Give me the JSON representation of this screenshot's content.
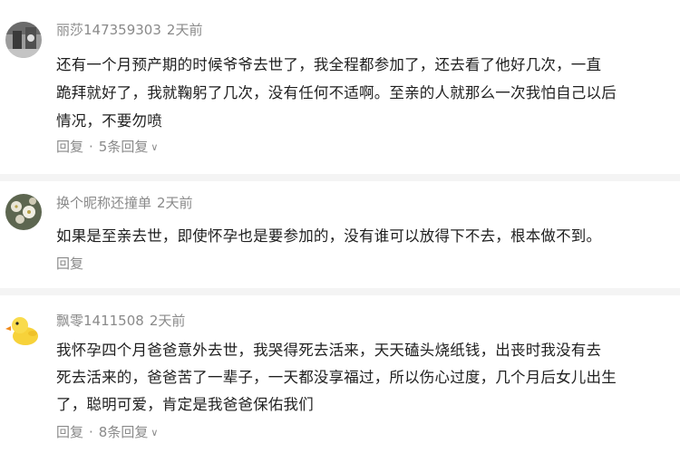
{
  "comments": [
    {
      "username": "丽莎147359303",
      "time": "2天前",
      "avatar_icon": "gray-photo-avatar",
      "lines": [
        "还有一个月预产期的时候爷爷去世了，我全程都参加了，还去看了他好几次，一直",
        "跪拜就好了，我就鞠躬了几次，没有任何不适啊。至亲的人就那么一次我怕自己以后",
        "情况，不要勿喷"
      ],
      "reply_label": "回复",
      "separator": "·",
      "replies_label": "5条回复"
    },
    {
      "username": "换个昵称还撞单",
      "time": "2天前",
      "avatar_icon": "flower-photo-avatar",
      "lines": [
        "如果是至亲去世，即使怀孕也是要参加的，没有谁可以放得下不去，根本做不到。"
      ],
      "reply_label": "回复"
    },
    {
      "username": "飘零1411508",
      "time": "2天前",
      "avatar_icon": "yellow-duck-avatar",
      "lines": [
        "我怀孕四个月爸爸意外去世，我哭得死去活来，天天磕头烧纸钱，出丧时我没有去",
        "死去活来的，爸爸苦了一辈子，一天都没享福过，所以伤心过度，几个月后女儿出生",
        "了，聪明可爱，肯定是我爸爸保佑我们"
      ],
      "reply_label": "回复",
      "separator": "·",
      "replies_label": "8条回复"
    }
  ]
}
